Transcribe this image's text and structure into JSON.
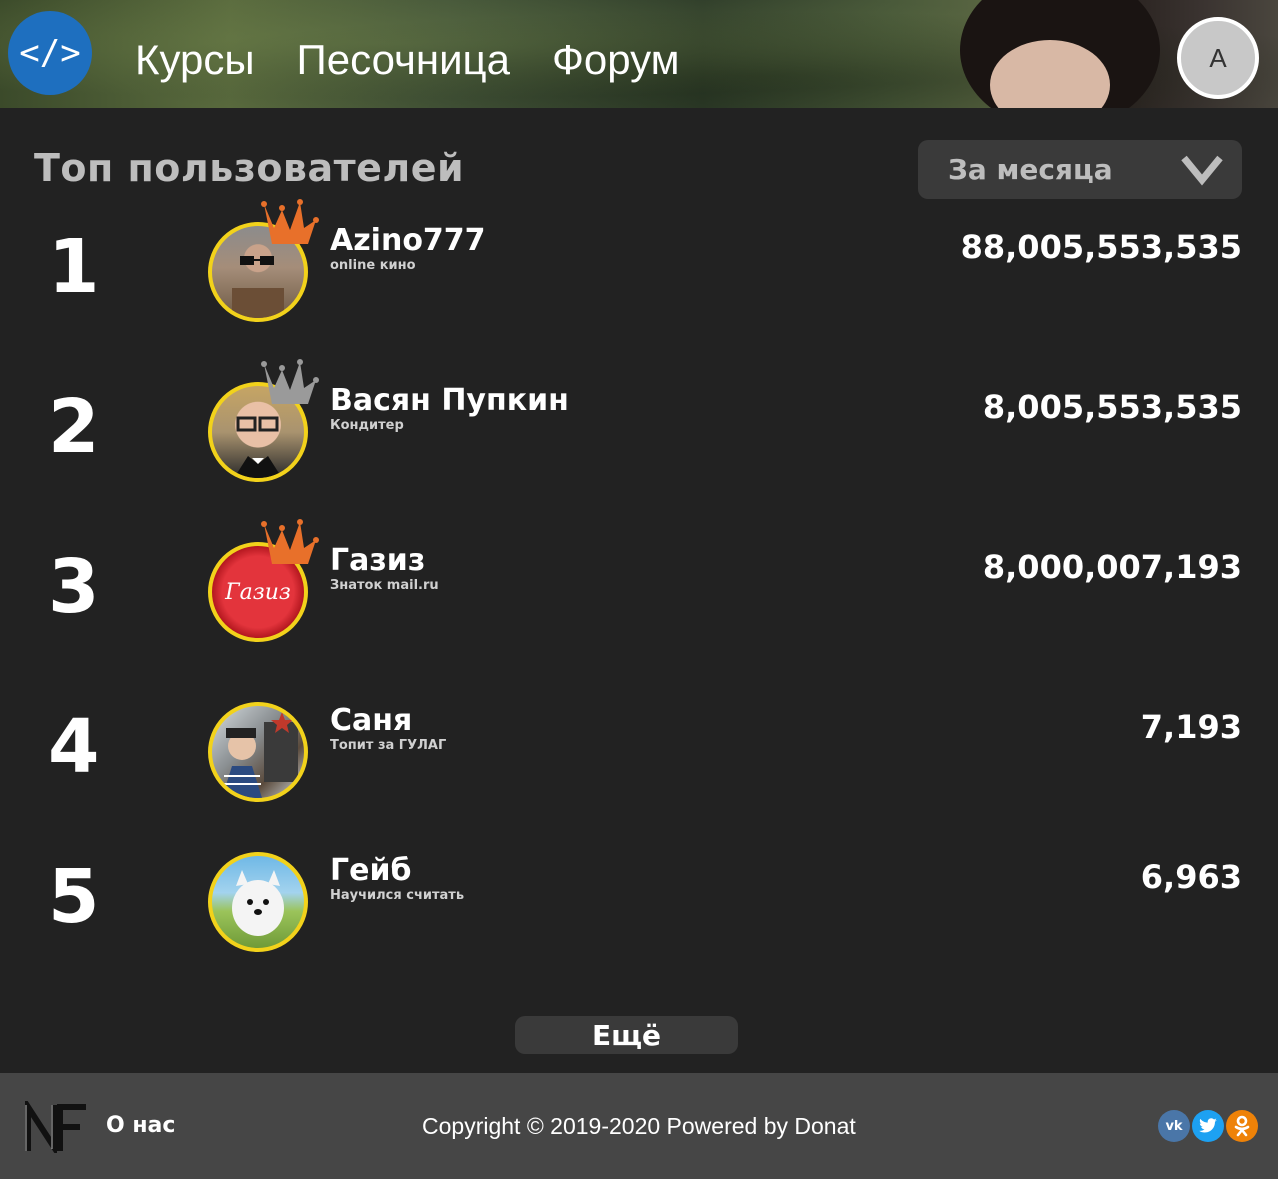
{
  "header": {
    "logo_text": "</>",
    "nav": [
      {
        "label": "Курсы"
      },
      {
        "label": "Песочница"
      },
      {
        "label": "Форум"
      }
    ],
    "avatar_letter": "A"
  },
  "page_title": "Топ пользователей",
  "period_select": {
    "value": "За месяца",
    "icon": "chevron-down-icon"
  },
  "users": [
    {
      "rank": "1",
      "name": "Azino777",
      "subtitle": "online кино",
      "score": "88,005,553,535",
      "crown": "orange"
    },
    {
      "rank": "2",
      "name": "Васян Пупкин",
      "subtitle": "Кондитер",
      "score": "8,005,553,535",
      "crown": "silver"
    },
    {
      "rank": "3",
      "name": "Газиз",
      "subtitle": "Знаток mail.ru",
      "score": "8,000,007,193",
      "crown": "orange"
    },
    {
      "rank": "4",
      "name": "Саня",
      "subtitle": "Топит за ГУЛАГ",
      "score": "7,193",
      "crown": null
    },
    {
      "rank": "5",
      "name": "Гейб",
      "subtitle": "Научился считать",
      "score": "6,963",
      "crown": null
    }
  ],
  "avatar3_text": "Газиз",
  "more_button": "Ещё",
  "footer": {
    "about": "О нас",
    "copyright": "Copyright © 2019-2020 Powered by Donat",
    "socials": [
      {
        "name": "vk-icon",
        "label": "vk",
        "color": "#4a76a8"
      },
      {
        "name": "twitter-icon",
        "label": "t",
        "color": "#1da1f2"
      },
      {
        "name": "odnoklassniki-icon",
        "label": "ok",
        "color": "#ee8208"
      }
    ]
  },
  "colors": {
    "accent": "#1e6fbf",
    "avatar_border": "#f2d21b",
    "crown_orange": "#e8702a",
    "crown_silver": "#9a9a9a"
  }
}
